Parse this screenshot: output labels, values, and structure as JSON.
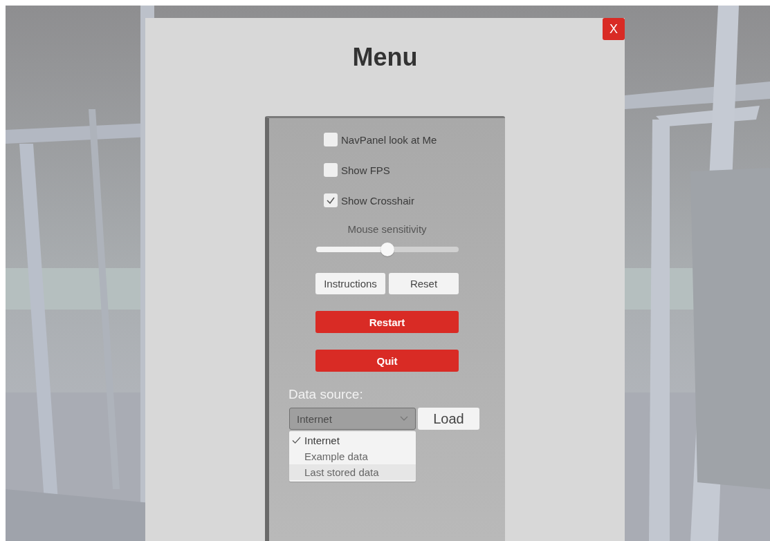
{
  "menu": {
    "title": "Menu",
    "close_button": "X"
  },
  "options": [
    {
      "label": "NavPanel look at Me",
      "checked": false
    },
    {
      "label": "Show FPS",
      "checked": false
    },
    {
      "label": "Show Crosshair",
      "checked": true
    }
  ],
  "mouse_sensitivity": {
    "label": "Mouse sensitivity",
    "level": 0.5
  },
  "buttons": [
    {
      "label": "Instructions",
      "kind": "plain"
    },
    {
      "label": "Reset",
      "kind": "plain"
    },
    {
      "label": "Restart",
      "kind": "primary"
    },
    {
      "label": "Quit",
      "kind": "primary"
    }
  ],
  "data_source": {
    "label": "Data source:",
    "value": "Internet",
    "load_button": "Load",
    "expanded": true,
    "options": [
      {
        "label": "Internet",
        "selected": true,
        "hovered": false
      },
      {
        "label": "Example data",
        "selected": false,
        "hovered": false
      },
      {
        "label": "Last stored data",
        "selected": false,
        "hovered": true
      }
    ]
  }
}
